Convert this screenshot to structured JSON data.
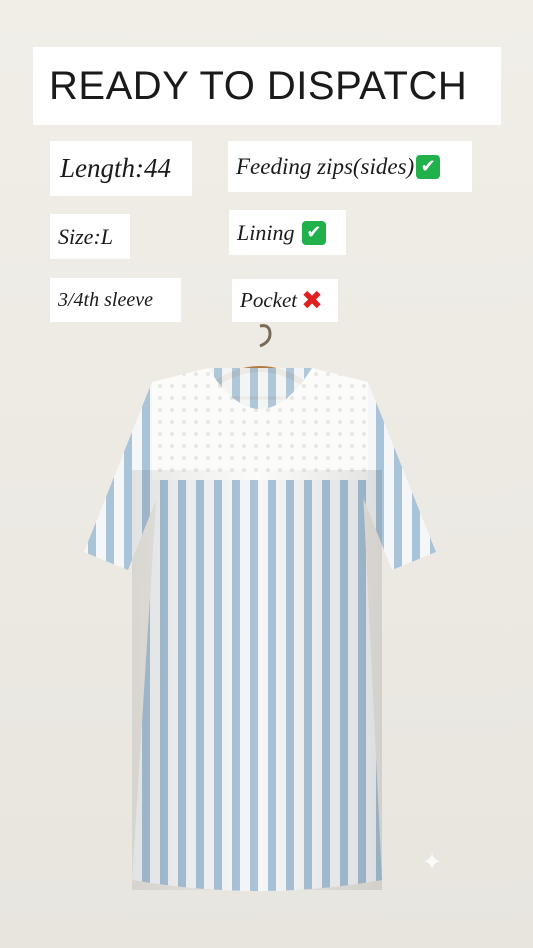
{
  "title": "READY TO DISPATCH",
  "tags": {
    "length": "Length:44",
    "feeding": "Feeding zips(sides)",
    "size": "Size:L",
    "lining": "Lining",
    "sleeve": "3/4th sleeve",
    "pocket": "Pocket"
  },
  "icons": {
    "check": "✔",
    "cross": "✖",
    "sparkle": "✦"
  },
  "colors": {
    "check_bg": "#21b14b",
    "cross": "#e02020",
    "stripe_blue": "#a9c3d8"
  }
}
